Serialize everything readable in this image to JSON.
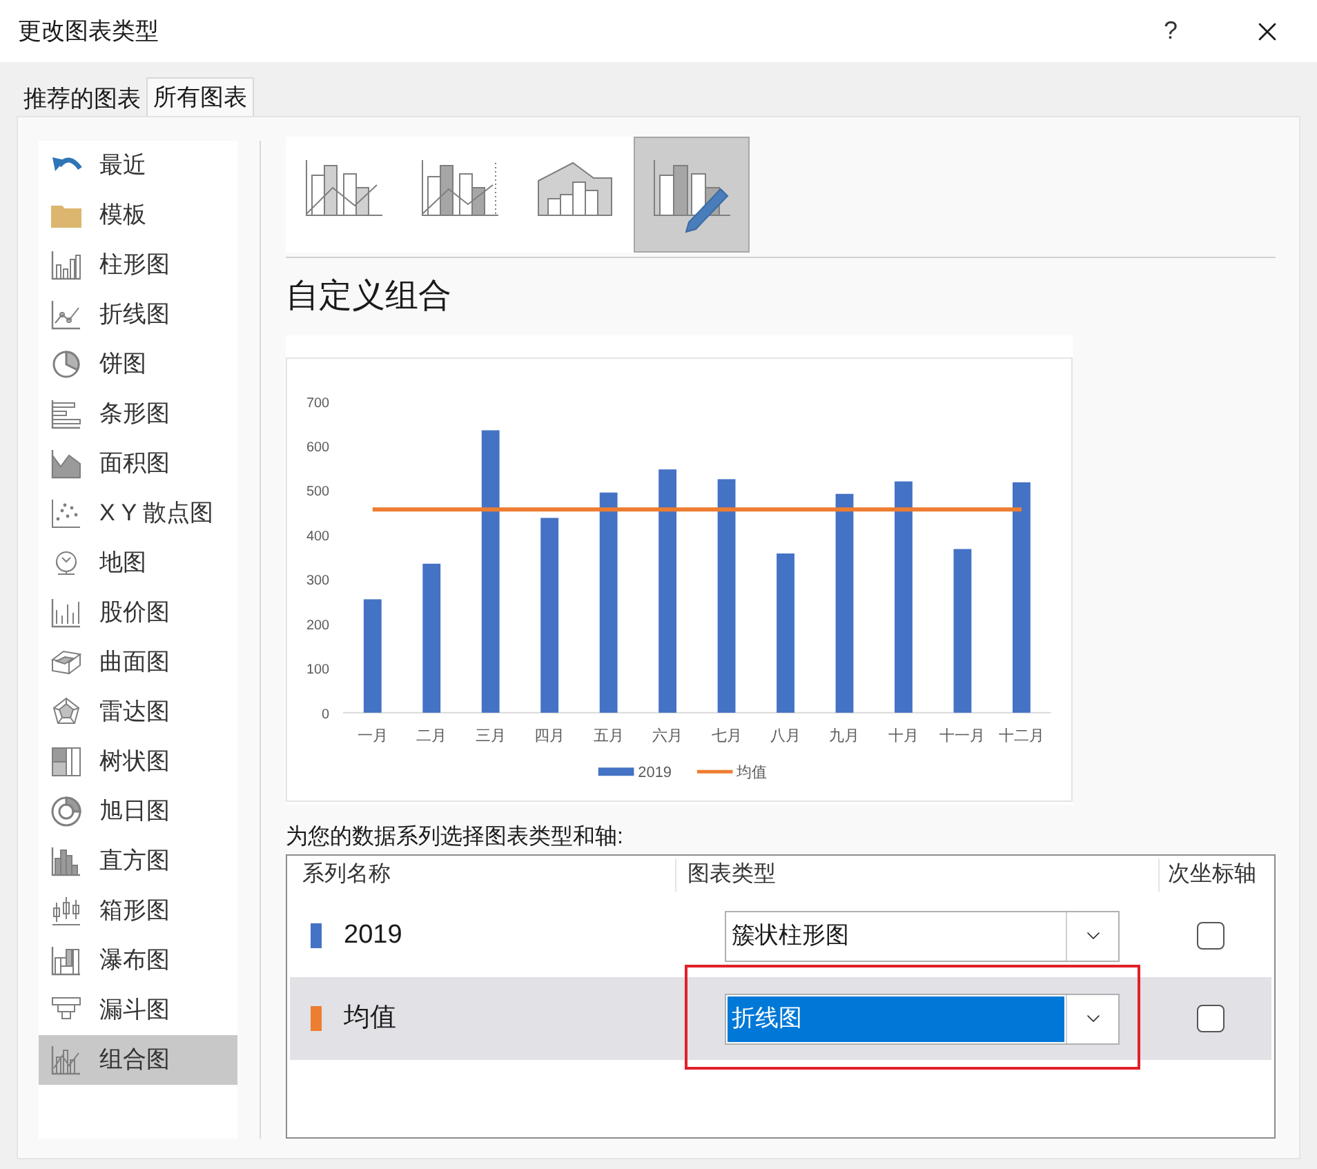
{
  "window": {
    "title": "更改图表类型",
    "help": "?"
  },
  "tabs": [
    {
      "label": "推荐的图表",
      "selected": false
    },
    {
      "label": "所有图表",
      "selected": true
    }
  ],
  "sidebar": {
    "items": [
      {
        "label": "最近",
        "selected": false
      },
      {
        "label": "模板",
        "selected": false
      },
      {
        "label": "柱形图",
        "selected": false
      },
      {
        "label": "折线图",
        "selected": false
      },
      {
        "label": "饼图",
        "selected": false
      },
      {
        "label": "条形图",
        "selected": false
      },
      {
        "label": "面积图",
        "selected": false
      },
      {
        "label": "X Y 散点图",
        "selected": false
      },
      {
        "label": "地图",
        "selected": false
      },
      {
        "label": "股价图",
        "selected": false
      },
      {
        "label": "曲面图",
        "selected": false
      },
      {
        "label": "雷达图",
        "selected": false
      },
      {
        "label": "树状图",
        "selected": false
      },
      {
        "label": "旭日图",
        "selected": false
      },
      {
        "label": "直方图",
        "selected": false
      },
      {
        "label": "箱形图",
        "selected": false
      },
      {
        "label": "瀑布图",
        "selected": false
      },
      {
        "label": "漏斗图",
        "selected": false
      },
      {
        "label": "组合图",
        "selected": true
      }
    ]
  },
  "subtypes": [
    {
      "selected": false
    },
    {
      "selected": false
    },
    {
      "selected": false
    },
    {
      "selected": true
    }
  ],
  "subtype_title": "自定义组合",
  "preview": {
    "chart_data": {
      "type": "bar",
      "categories": [
        "一月",
        "二月",
        "三月",
        "四月",
        "五月",
        "六月",
        "七月",
        "八月",
        "九月",
        "十月",
        "十一月",
        "十二月"
      ],
      "series": [
        {
          "name": "2019",
          "color": "#4472c4",
          "type": "bar",
          "values": [
            255,
            335,
            635,
            438,
            495,
            547,
            525,
            358,
            492,
            520,
            368,
            518
          ]
        },
        {
          "name": "均值",
          "color": "#ed7d31",
          "type": "line",
          "values": [
            457,
            457,
            457,
            457,
            457,
            457,
            457,
            457,
            457,
            457,
            457,
            457
          ]
        }
      ],
      "legend": "bottom",
      "ylim": [
        0,
        700
      ],
      "yticks": [
        0,
        100,
        200,
        300,
        400,
        500,
        600,
        700
      ]
    }
  },
  "series_table": {
    "caption": "为您的数据系列选择图表类型和轴:",
    "columns": [
      "系列名称",
      "图表类型",
      "次坐标轴"
    ],
    "rows": [
      {
        "name": "2019",
        "color": "#4472c4",
        "chart_type": "簇状柱形图",
        "secondary_axis": false,
        "selected": false,
        "marked": false
      },
      {
        "name": "均值",
        "color": "#ed7d31",
        "chart_type": "折线图",
        "secondary_axis": false,
        "selected": true,
        "marked": true
      }
    ]
  }
}
